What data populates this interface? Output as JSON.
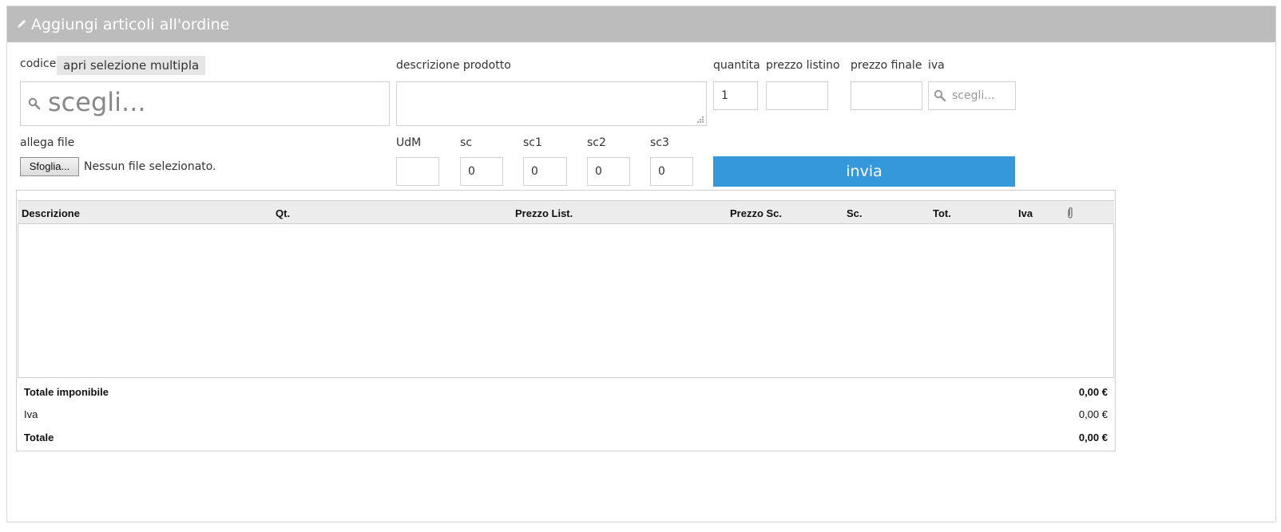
{
  "header": {
    "title": "Aggiungi articoli all'ordine"
  },
  "form": {
    "codice_label": "codice",
    "multi_select_label": "apri selezione multipla",
    "codice_placeholder": "scegli...",
    "descrizione_label": "descrizione prodotto",
    "quantita_label": "quantita",
    "quantita_value": "1",
    "prezzo_listino_label": "prezzo listino",
    "prezzo_finale_label": "prezzo finale",
    "iva_label": "iva",
    "iva_placeholder": "scegli...",
    "allega_label": "allega file",
    "browse_label": "Sfoglia...",
    "no_file_text": "Nessun file selezionato.",
    "udm_label": "UdM",
    "sc_label": "sc",
    "sc_value": "0",
    "sc1_label": "sc1",
    "sc1_value": "0",
    "sc2_label": "sc2",
    "sc2_value": "0",
    "sc3_label": "sc3",
    "sc3_value": "0",
    "submit_label": "invia"
  },
  "table": {
    "columns": [
      "Descrizione",
      "Qt.",
      "Prezzo List.",
      "Prezzo Sc.",
      "Sc.",
      "Tot.",
      "Iva"
    ],
    "rows": []
  },
  "totals": {
    "imponibile_label": "Totale imponibile",
    "imponibile_value": "0,00 €",
    "iva_label": "Iva",
    "iva_value": "0,00 €",
    "totale_label": "Totale",
    "totale_value": "0,00 €"
  },
  "colors": {
    "header_bg": "#bcbcbc",
    "accent": "#3498db"
  },
  "icons": {
    "header": "pencil-icon",
    "select": "search-icon",
    "attachment": "paperclip-icon"
  }
}
